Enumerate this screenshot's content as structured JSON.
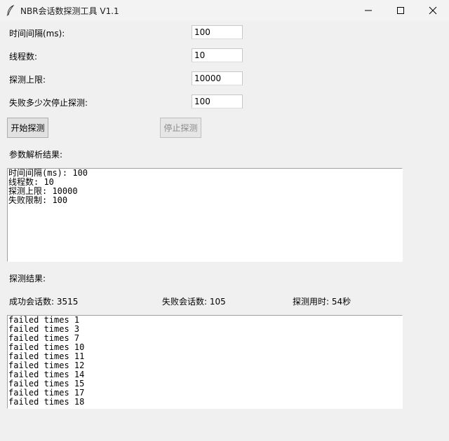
{
  "window": {
    "title": "NBR会话数探测工具 V1.1",
    "controls": [
      "minimize",
      "maximize",
      "close"
    ]
  },
  "form": {
    "interval_label": "时间间隔(ms):",
    "interval_value": "100",
    "threads_label": "线程数:",
    "threads_value": "10",
    "limit_label": "探测上限:",
    "limit_value": "10000",
    "fail_label": "失败多少次停止探测:",
    "fail_value": "100"
  },
  "buttons": {
    "start": "开始探测",
    "stop": "停止探测"
  },
  "params": {
    "header": "参数解析结果:",
    "lines": [
      "时间间隔(ms): 100",
      "线程数: 10",
      "探测上限: 10000",
      "失败限制: 100"
    ]
  },
  "results": {
    "header": "探测结果:",
    "success": "成功会话数: 3515",
    "failed": "失败会话数: 105",
    "elapsed": "探测用时: 54秒",
    "log": [
      "failed times 1",
      "failed times 3",
      "failed times 7",
      "failed times 10",
      "failed times 11",
      "failed times 12",
      "failed times 14",
      "failed times 15",
      "failed times 17",
      "failed times 18"
    ]
  },
  "colors": {
    "window_bg": "#f0f0f0",
    "button_bg": "#e1e1e1",
    "disabled_text": "#8a8a8a"
  }
}
